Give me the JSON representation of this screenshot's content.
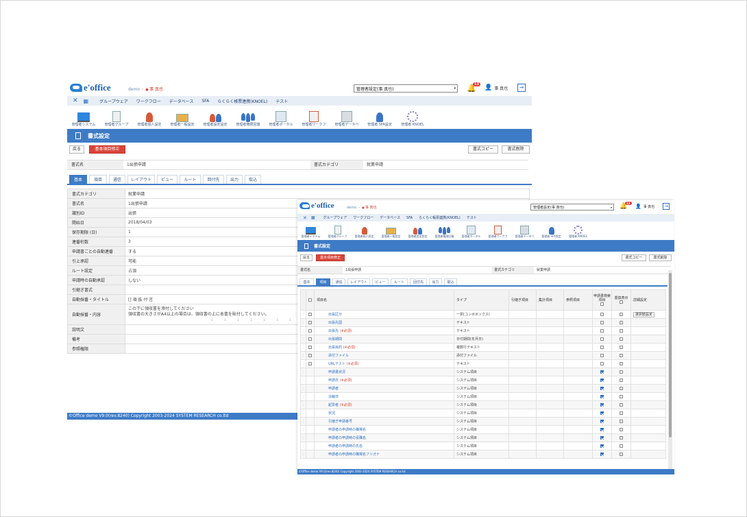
{
  "app": {
    "logo": "e'office",
    "crumb_site": "demo",
    "crumb_user": "事 真也"
  },
  "header": {
    "mode_select": "管理者設定(事 真也)",
    "notify_count": "13",
    "user_name": "事 真也"
  },
  "menu": [
    "グループウェア",
    "ワークフロー",
    "データベース",
    "SFA",
    "らくらく帳票連携(KNOEL)",
    "テスト"
  ],
  "admin_icons": [
    "管理者システム",
    "管理者グループ",
    "管理者個人設定",
    "管理者一般設定",
    "管理者設定設定",
    "管理者権限回復",
    "管理者ポータル",
    "管理者ワークフ",
    "管理者データベ",
    "管理者 SFA設定",
    "管理者 KNOEL"
  ],
  "page_title": "書式設定",
  "actions": {
    "back": "戻る",
    "edit_basic": "基本項目修正",
    "copy": "書式コピー",
    "delete": "書式削除"
  },
  "form_name": {
    "label": "書式名",
    "value": "1出張申請"
  },
  "form_category": {
    "label": "書式カテゴリ",
    "value": "就業申請"
  },
  "tabs": [
    "基本",
    "項目",
    "通信",
    "レイアウト",
    "ビュー",
    "ルート",
    "回付先",
    "出力",
    "取込"
  ],
  "basic_rows": [
    {
      "label": "書式カテゴリ",
      "value": "就業申請"
    },
    {
      "label": "書式名",
      "value": "1出張申請"
    },
    {
      "label": "識別ID",
      "value": "出張"
    },
    {
      "label": "開始日",
      "value": "2018/04/03"
    },
    {
      "label": "保存期限 (日)",
      "value": "1"
    },
    {
      "label": "連番桁数",
      "value": "3"
    },
    {
      "label": "申請書ごとの自動連番",
      "value": "する"
    },
    {
      "label": "引上承認",
      "value": "可能"
    },
    {
      "label": "ルート設定",
      "value": "占須"
    },
    {
      "label": "申請時の自動承認",
      "value": "しない"
    },
    {
      "label": "引継ぎ書式",
      "value": ""
    },
    {
      "label": "自動採番・タイトル",
      "value": "[] 項 抜 付 言"
    },
    {
      "label": "自動採番・内容",
      "value": "この下に領収書を添付してください",
      "value2": "領収書の大きさがA4以上の場合は、領収書の上に本書を貼付してください。"
    },
    {
      "label": "説明文",
      "value": ""
    },
    {
      "label": "備考",
      "value": ""
    },
    {
      "label": "参照権限",
      "value": ""
    }
  ],
  "footer": "©Office demo V9.0(rev.8240) Copyright 2003-2024 SYSTEM RESEARCH co.ltd",
  "items_table": {
    "headers": {
      "name": "項目名",
      "type": "タイプ",
      "c1": "引継ぎ項目",
      "c2": "集計項目",
      "c3": "参照項目",
      "c4": "申請書検索項目",
      "c5": "置換表示",
      "c6": "詳細設定"
    },
    "detail_button": "選択肢設定",
    "rows": [
      {
        "name": "出張区分",
        "req": "",
        "type": "一択(コンボボックス)",
        "c4": false,
        "c5": false,
        "user": true
      },
      {
        "name": "出張先国",
        "req": "",
        "type": "テキスト",
        "c4": false,
        "c5": false,
        "user": true
      },
      {
        "name": "出張先",
        "req": "(※必須)",
        "type": "テキスト",
        "c4": false,
        "c5": false,
        "user": true
      },
      {
        "name": "出張期間",
        "req": "",
        "type": "日付期間(年月日)",
        "c4": false,
        "c5": false,
        "user": true
      },
      {
        "name": "出張目的",
        "req": "(※必須)",
        "type": "複数行テキスト",
        "c4": false,
        "c5": false,
        "user": true
      },
      {
        "name": "添付ファイル",
        "req": "",
        "type": "添付ファイル",
        "c4": false,
        "c5": false,
        "user": true
      },
      {
        "name": "URLテスト",
        "req": "(※必須)",
        "type": "テキスト",
        "c4": false,
        "c5": false,
        "user": true
      },
      {
        "name": "申請書状況",
        "req": "",
        "type": "システム項目",
        "c4": true,
        "c5": false,
        "user": false
      },
      {
        "name": "申請日",
        "req": "(※必須)",
        "type": "システム項目",
        "c4": true,
        "c5": false,
        "user": false
      },
      {
        "name": "申請者",
        "req": "",
        "type": "システム項目",
        "c4": true,
        "c5": false,
        "user": false
      },
      {
        "name": "決裁日",
        "req": "",
        "type": "システム項目",
        "c4": true,
        "c5": false,
        "user": false
      },
      {
        "name": "起票者",
        "req": "(※必須)",
        "type": "システム項目",
        "c4": true,
        "c5": false,
        "user": false
      },
      {
        "name": "状況",
        "req": "",
        "type": "システム項目",
        "c4": true,
        "c5": false,
        "user": false
      },
      {
        "name": "引継ぎ申請番号",
        "req": "",
        "type": "システム項目",
        "c4": true,
        "c5": false,
        "user": false
      },
      {
        "name": "申請者の申請時の職場名",
        "req": "",
        "type": "システム項目",
        "c4": true,
        "c5": false,
        "user": false
      },
      {
        "name": "申請者の申請時の役職名",
        "req": "",
        "type": "システム項目",
        "c4": true,
        "c5": false,
        "user": false
      },
      {
        "name": "申請者の申請時の氏名",
        "req": "",
        "type": "システム項目",
        "c4": true,
        "c5": false,
        "user": false
      },
      {
        "name": "申請者の申請時の職場名フリガナ",
        "req": "",
        "type": "システム項目",
        "c4": true,
        "c5": false,
        "user": false
      }
    ]
  },
  "colors": {
    "accent": "#3e7bc6",
    "danger": "#d8453a",
    "required": "#d03d2f"
  }
}
